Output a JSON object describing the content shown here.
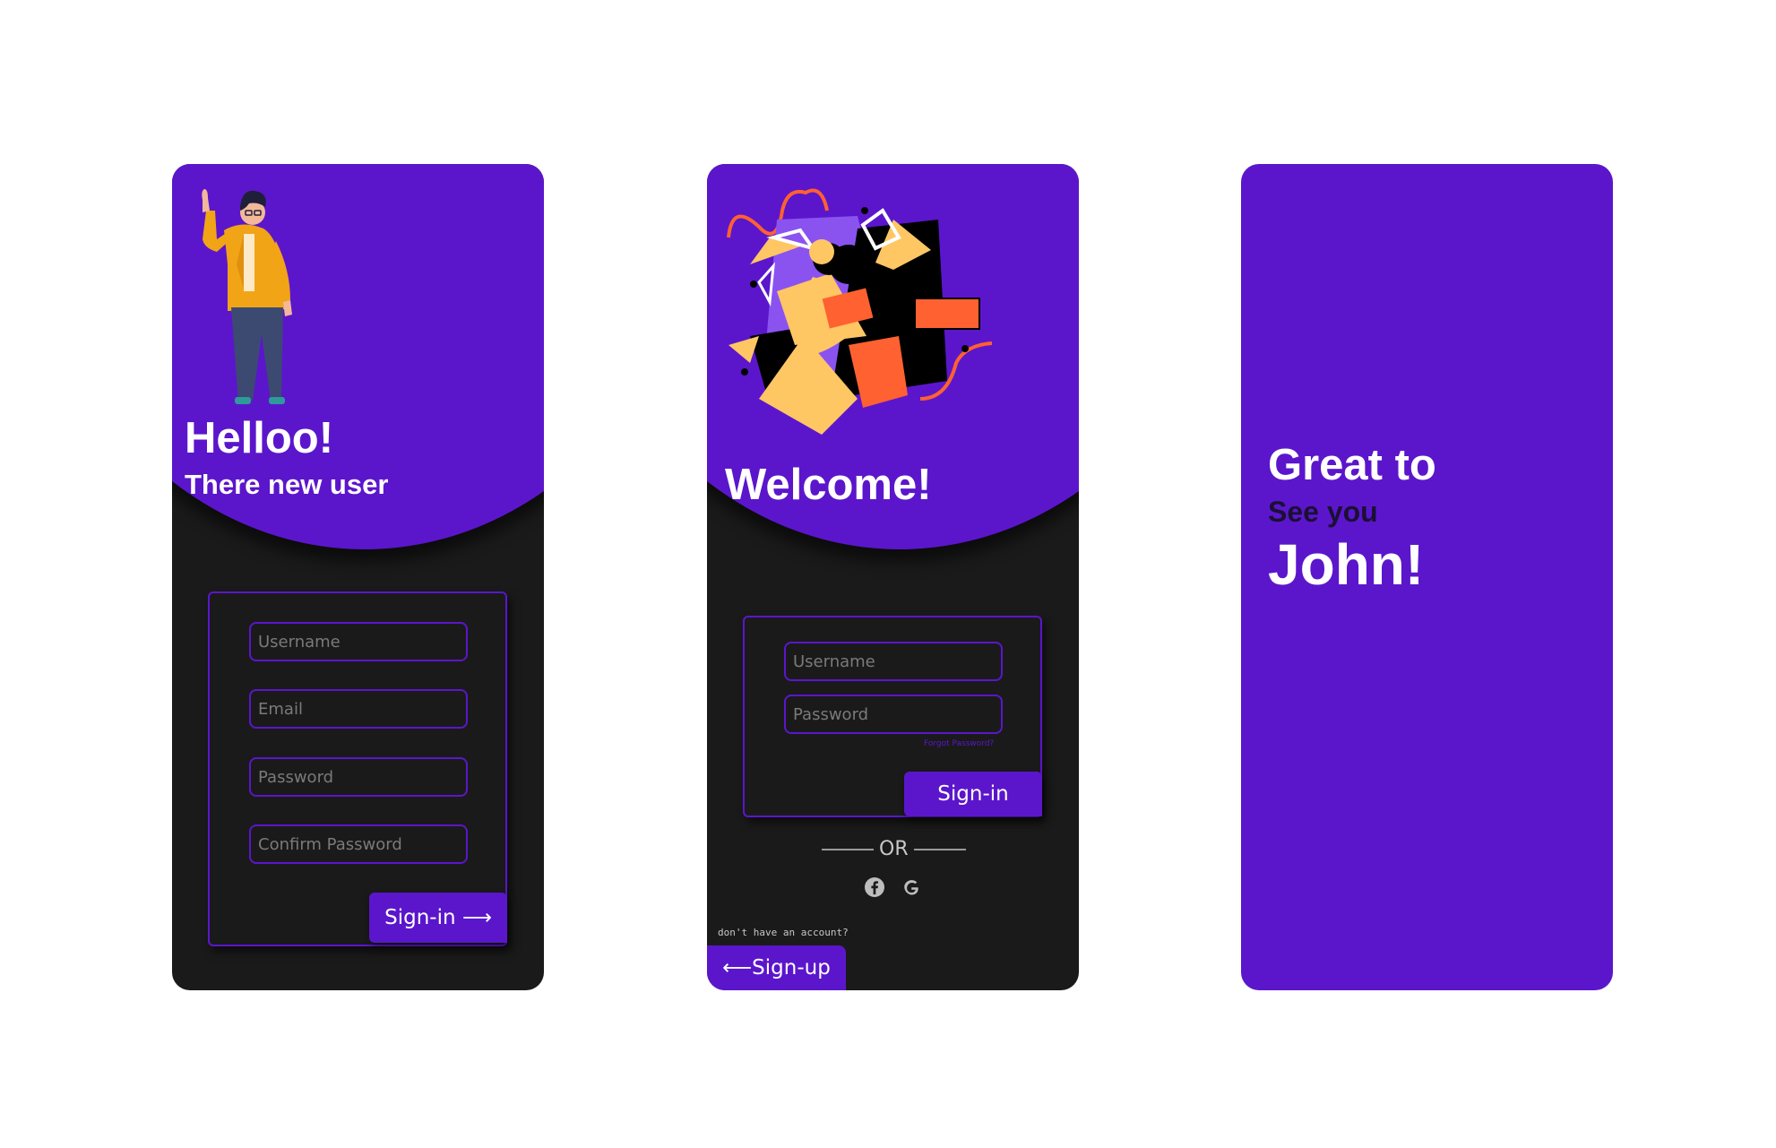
{
  "colors": {
    "brand": "#5b16cc",
    "card_dark": "#1a1a1a",
    "page_bg": "#ffffff",
    "accent_orange": "#ff6130",
    "accent_yellow": "#ffc664"
  },
  "signup_screen": {
    "title": "Helloo!",
    "subtitle": "There new user",
    "fields": {
      "username": "Username",
      "email": "Email",
      "password": "Password",
      "confirm": "Confirm Password"
    },
    "button": "Sign-in ⟶",
    "illustration": "waving-person-icon"
  },
  "signin_screen": {
    "title": "Welcome!",
    "fields": {
      "username": "Username",
      "password": "Password"
    },
    "forgot": "Forgot Password?",
    "button": "Sign-in",
    "or_text": "OR",
    "social": [
      "facebook-icon",
      "google-icon"
    ],
    "no_account": "don't have an account?",
    "signup_button": "⟵Sign-up",
    "illustration": "abstract-shapes-person-icon"
  },
  "greeting_screen": {
    "line1": "Great to",
    "line2": "See you",
    "line3": "John!"
  }
}
